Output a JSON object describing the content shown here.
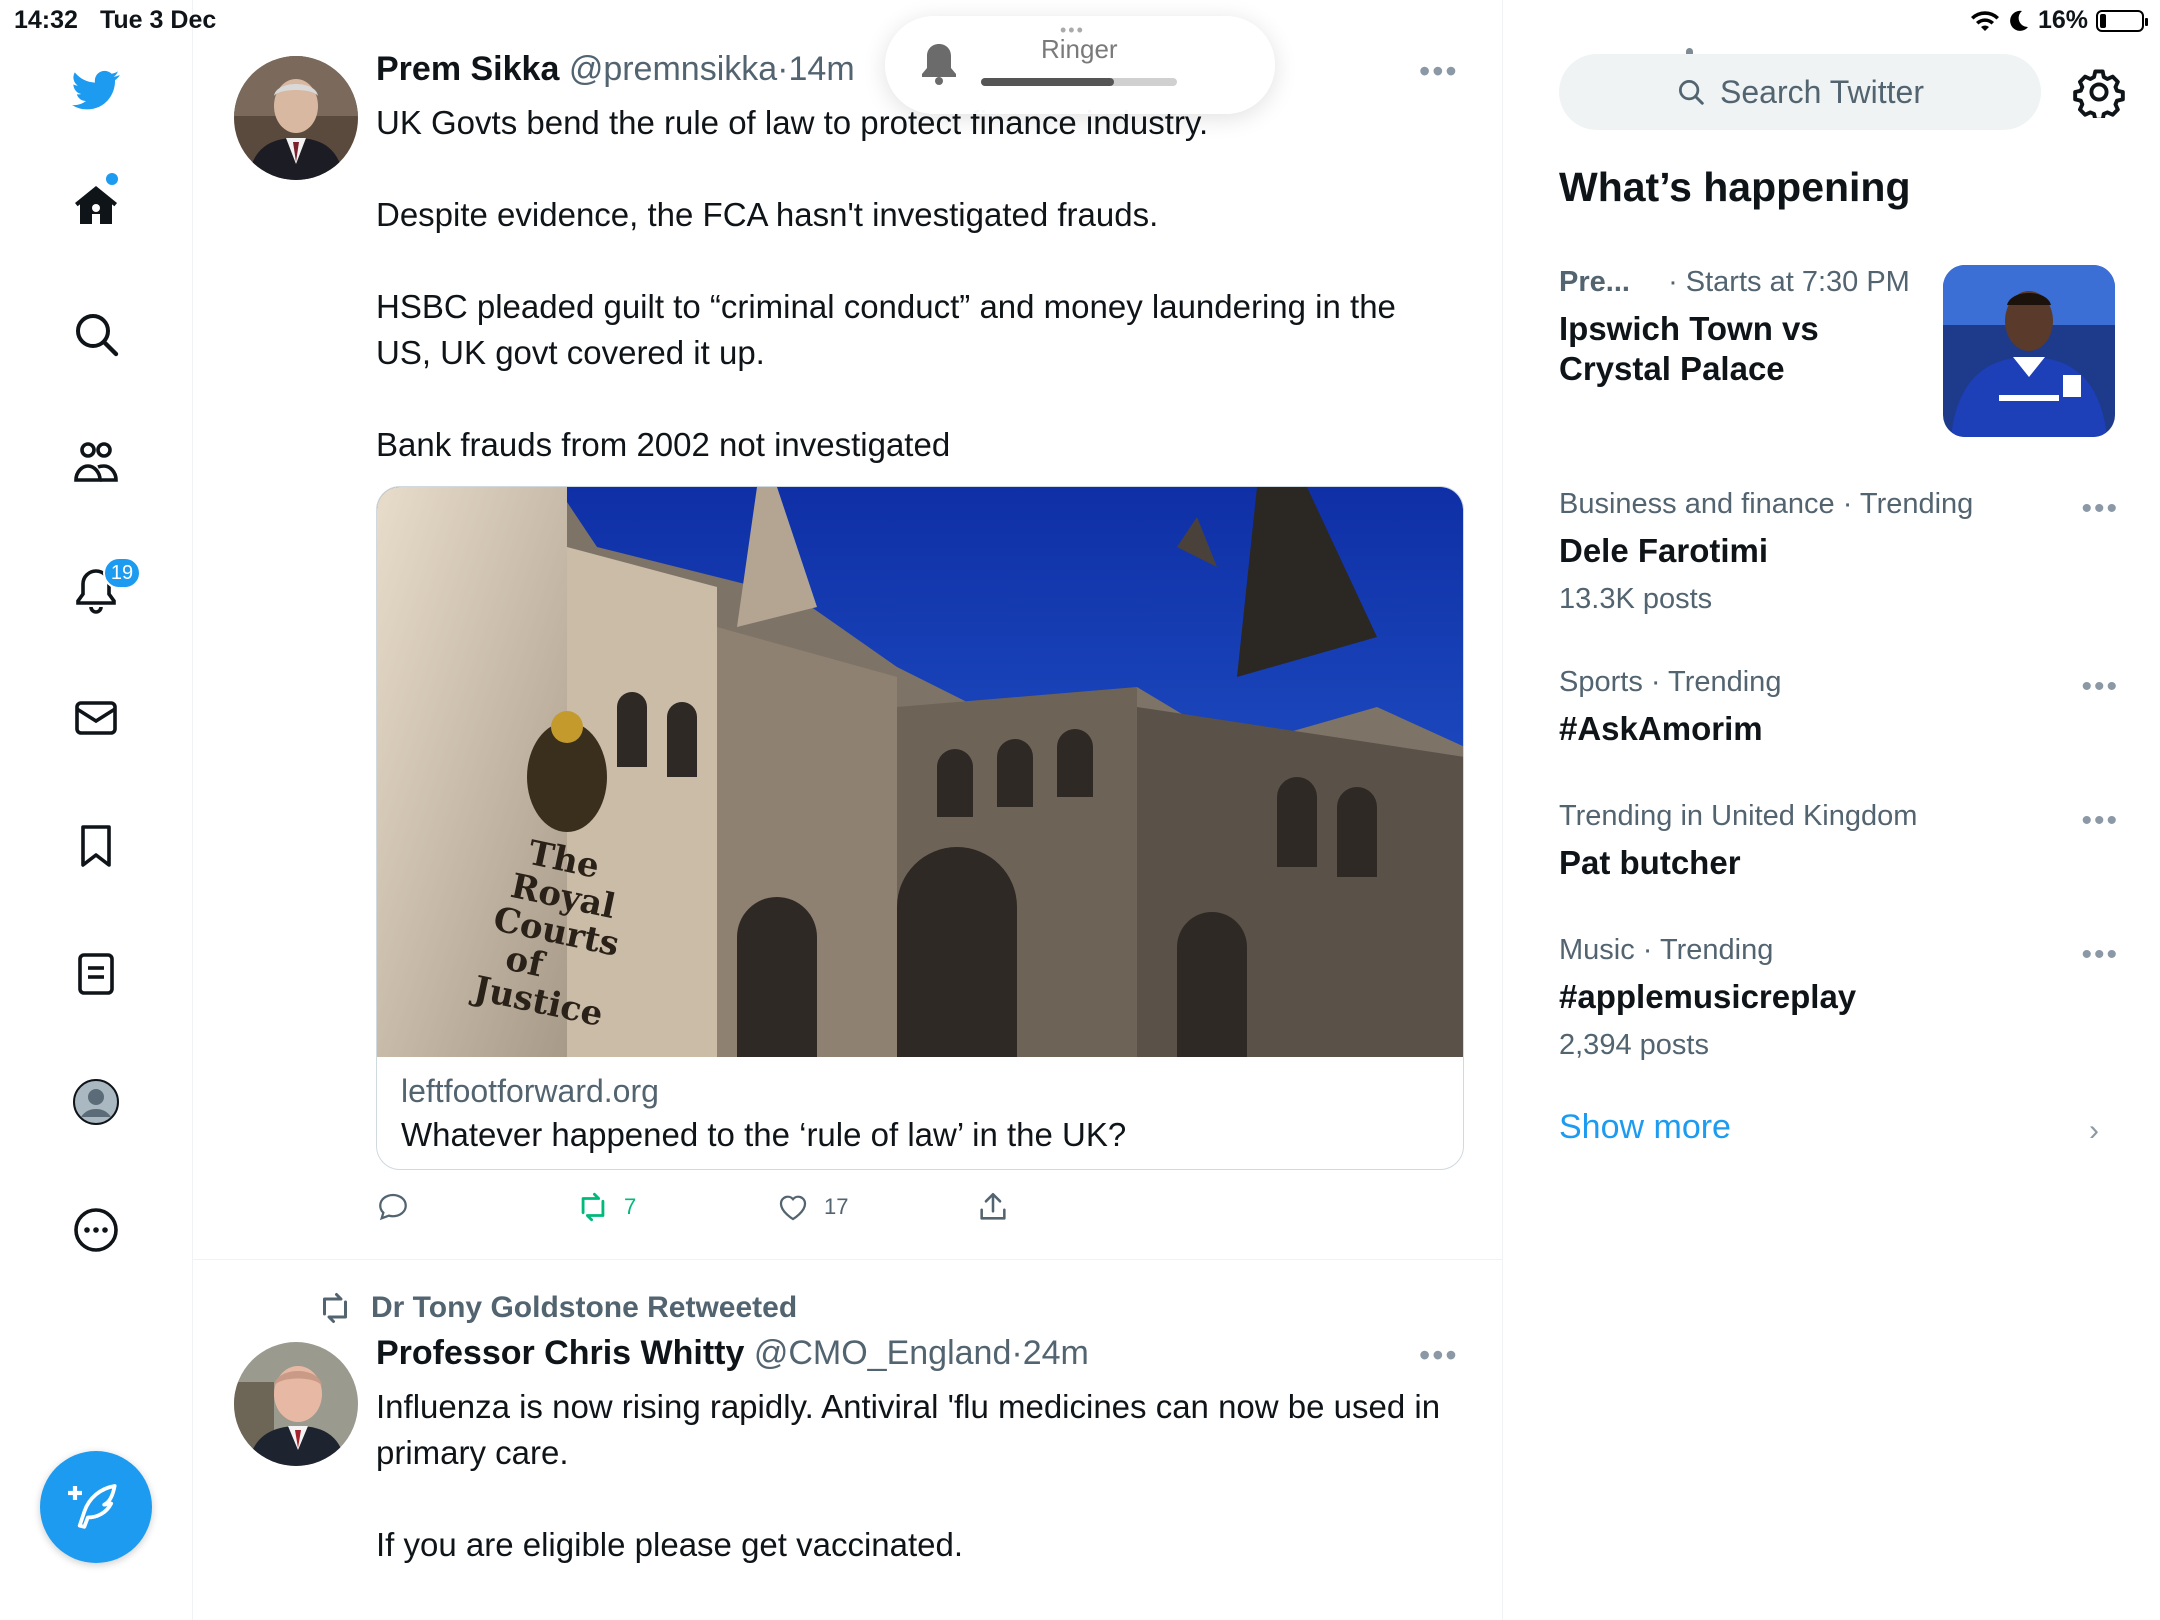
{
  "status_bar": {
    "time": "14:32",
    "date": "Tue 3 Dec",
    "battery": "16%",
    "battery_level": 0.16
  },
  "ringer_hud": {
    "label": "Ringer",
    "level": 0.68
  },
  "nav": {
    "notifications_count": "19"
  },
  "timeline": {
    "tweet1": {
      "name": "Prem Sikka",
      "handle": "@premnsikka",
      "time": "14m",
      "paragraphs": [
        "UK Govts bend the rule of law to protect finance industry.",
        "Despite evidence, the FCA hasn't investigated frauds.",
        "HSBC pleaded guilt to “criminal conduct” and money laundering in the US, UK govt covered it up.",
        "Bank frauds from 2002  not investigated"
      ],
      "card": {
        "image_text": "The Royal Courts of Justice",
        "domain": "leftfootforward.org",
        "title": "Whatever happened to the ‘rule of law’ in the UK?"
      },
      "retweets": "7",
      "likes": "17"
    },
    "tweet2": {
      "retweeted_by": "Dr Tony Goldstone Retweeted",
      "name": "Professor Chris Whitty",
      "handle": "@CMO_England",
      "time": "24m",
      "paragraphs": [
        "Influenza is now rising rapidly. Antiviral 'flu medicines can now be used in primary care.",
        "If you are eligible please get vaccinated."
      ]
    }
  },
  "sidebar": {
    "search_placeholder": "Search Twitter",
    "section_title": "What’s happening",
    "event": {
      "category": "Pre...",
      "time": "· Starts at 7:30 PM",
      "title": "Ipswich Town vs Crystal Palace"
    },
    "trends": [
      {
        "meta": "Business and finance · Trending",
        "title": "Dele Farotimi",
        "count": "13.3K posts"
      },
      {
        "meta": "Sports · Trending",
        "title": "#AskAmorim",
        "count": ""
      },
      {
        "meta": "Trending in United Kingdom",
        "title": "Pat butcher",
        "count": ""
      },
      {
        "meta": "Music · Trending",
        "title": "#applemusicreplay",
        "count": "2,394 posts"
      }
    ],
    "show_more": "Show more"
  },
  "colors": {
    "accent": "#1d9bf0",
    "retweet_green": "#00ba7c",
    "secondary_text": "#536471"
  }
}
